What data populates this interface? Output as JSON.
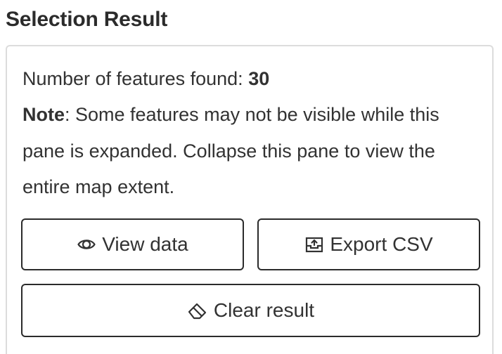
{
  "panel": {
    "title": "Selection Result",
    "count_label": "Number of features found:",
    "count_value": "30",
    "note_label": "Note",
    "note_text": ": Some features may not be visible while this pane is expanded. Collapse this pane to view the entire map extent."
  },
  "actions": {
    "view_data": {
      "label": "View data",
      "icon": "eye-icon"
    },
    "export_csv": {
      "label": "Export CSV",
      "icon": "export-icon"
    },
    "clear_result": {
      "label": "Clear result",
      "icon": "eraser-icon"
    }
  }
}
